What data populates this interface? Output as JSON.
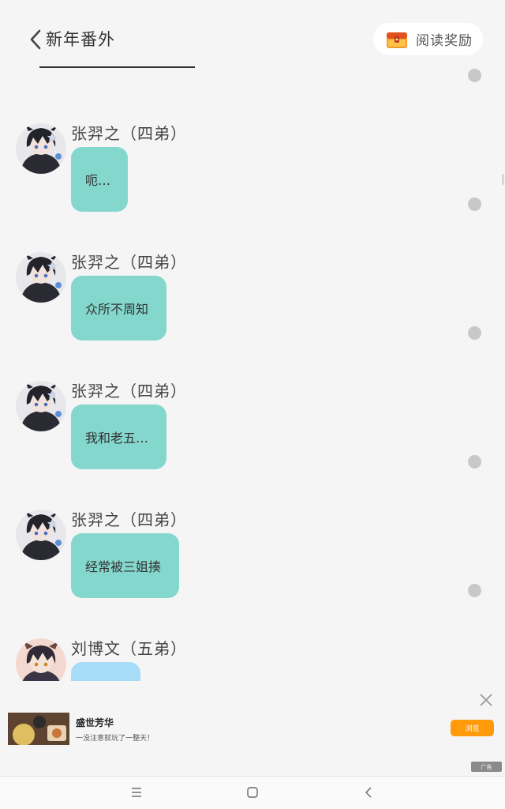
{
  "header": {
    "title": "新年番外",
    "reward_label": "阅读奖励"
  },
  "messages": [
    {
      "sender": "张羿之（四弟）",
      "text": "呃…",
      "bubble_color": "#84d7cd"
    },
    {
      "sender": "张羿之（四弟）",
      "text": "众所不周知",
      "bubble_color": "#84d7cd"
    },
    {
      "sender": "张羿之（四弟）",
      "text": "我和老五…",
      "bubble_color": "#84d7cd"
    },
    {
      "sender": "张羿之（四弟）",
      "text": "经常被三姐揍",
      "bubble_color": "#84d7cd"
    },
    {
      "sender": "刘博文（五弟）",
      "text": "",
      "bubble_color": "#a6dcf7"
    }
  ],
  "ad": {
    "title": "盛世芳华",
    "description": "一没注意就玩了一整天！",
    "button_label": "浏览",
    "tag": "广告"
  },
  "colors": {
    "background": "#f5f5f5",
    "bubble_green": "#84d7cd",
    "bubble_blue": "#a6dcf7",
    "ad_button": "#ff9a0a"
  }
}
